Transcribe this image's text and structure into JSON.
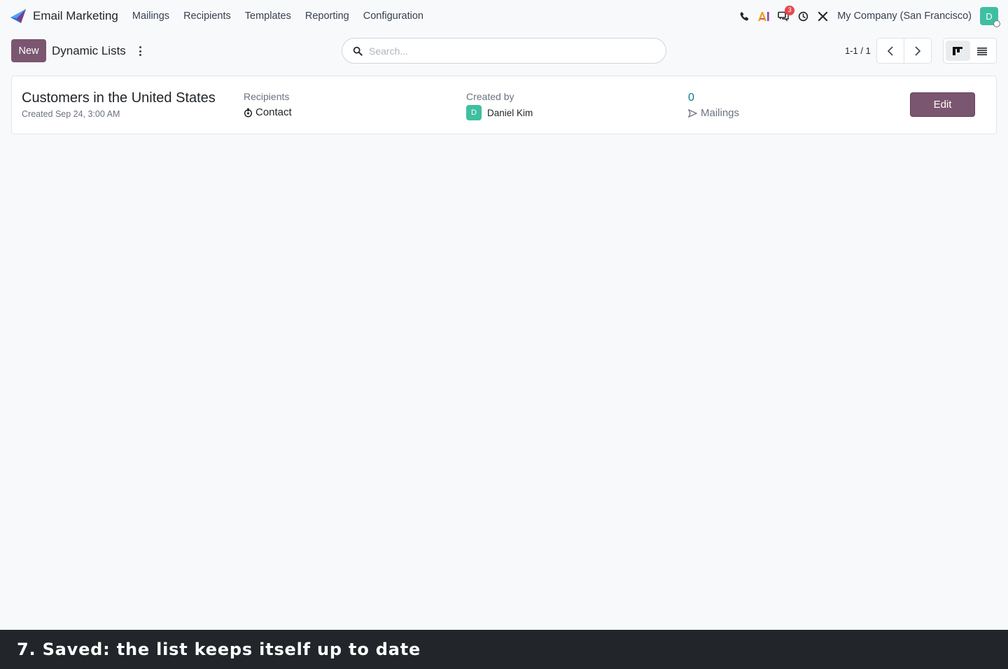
{
  "navbar": {
    "app_name": "Email Marketing",
    "menu": [
      "Mailings",
      "Recipients",
      "Templates",
      "Reporting",
      "Configuration"
    ],
    "icons": [
      "phone-icon",
      "ai-icon",
      "messages-icon",
      "activity-clock-icon",
      "tools-icon"
    ],
    "message_badge": "3",
    "company": "My Company (San Francisco)",
    "user_initial": "D"
  },
  "control_panel": {
    "new_label": "New",
    "title": "Dynamic Lists",
    "search_placeholder": "Search...",
    "pager": "1-1 / 1",
    "views": [
      "kanban-view",
      "list-view"
    ],
    "active_view": "kanban-view"
  },
  "record": {
    "name": "Customers in the United States",
    "created": "Created Sep 24, 3:00 AM",
    "recipients_label": "Recipients",
    "recipients_value": "Contact",
    "created_by_label": "Created by",
    "creator_initial": "D",
    "creator_name": "Daniel Kim",
    "mailings_count": "0",
    "mailings_label": "Mailings",
    "edit_label": "Edit"
  },
  "caption": "7. Saved: the list keeps itself up to date",
  "colors": {
    "primary": "#7b5670",
    "avatar": "#3fbfa1",
    "stat_link": "#017e84",
    "badge": "#e5484d",
    "caption_bg": "#22262a"
  }
}
